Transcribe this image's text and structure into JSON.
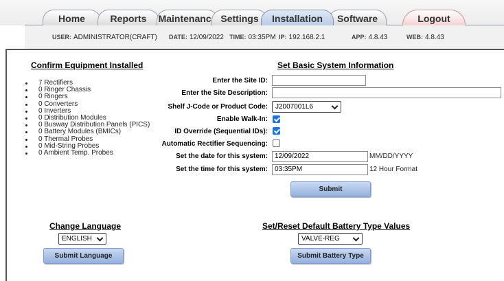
{
  "tabs": [
    {
      "label": "Home"
    },
    {
      "label": "Reports"
    },
    {
      "label": "Maintenance"
    },
    {
      "label": "Settings"
    },
    {
      "label": "Installation"
    },
    {
      "label": "Software"
    },
    {
      "label": "Logout"
    }
  ],
  "active_tab": "Installation",
  "info": {
    "user_label": "USER:",
    "user": "ADMINISTRATOR(CRAFT)",
    "date_label": "DATE:",
    "date": "12/09/2022",
    "time_label": "TIME:",
    "time": "03:35PM",
    "ip_label": "IP:",
    "ip": "192.168.2.1",
    "app_label": "APP:",
    "app": "4.8.43",
    "web_label": "WEB:",
    "web": "4.8.43"
  },
  "equipment": {
    "title": "Confirm Equipment Installed",
    "items": [
      "7 Rectifiers",
      "0 Ringer Chassis",
      "0 Ringers",
      "0 Converters",
      "0 Inverters",
      "0 Distribution Modules",
      "0 Busway Distribution Panels (PICS)",
      "0 Battery Modules (BMICs)",
      "0 Thermal Probes",
      "0 Mid-String Probes",
      "0 Ambient Temp. Probes"
    ]
  },
  "system": {
    "title": "Set Basic System Information",
    "site_id_label": "Enter the Site ID:",
    "site_id_value": "",
    "site_desc_label": "Enter the Site Description:",
    "site_desc_value": "",
    "jcode_label": "Shelf J-Code or Product Code:",
    "jcode_value": "J2007001L6",
    "walkin_label": "Enable Walk-In:",
    "walkin_checked": true,
    "idoverride_label": "ID Override (Sequential IDs):",
    "idoverride_checked": true,
    "autoseq_label": "Automatic Rectifier Sequencing:",
    "autoseq_checked": false,
    "date_label": "Set the date for this system:",
    "date_value": "12/09/2022",
    "date_hint": "MM/DD/YYYY",
    "time_label": "Set the time for this system:",
    "time_value": "03:35PM",
    "time_hint": "12 Hour Format",
    "submit_label": "Submit"
  },
  "language": {
    "title": "Change Language",
    "selected": "ENGLISH",
    "submit_label": "Submit Language"
  },
  "battery": {
    "title": "Set/Reset Default Battery Type Values",
    "selected": "VALVE-REG",
    "submit_label": "Submit Battery Type"
  },
  "colors": {
    "active_tab": "#b9cbe4",
    "logout_tab": "#f4d2d2",
    "button": "#94b0dd",
    "checkbox_checked": "#1a73e8"
  }
}
